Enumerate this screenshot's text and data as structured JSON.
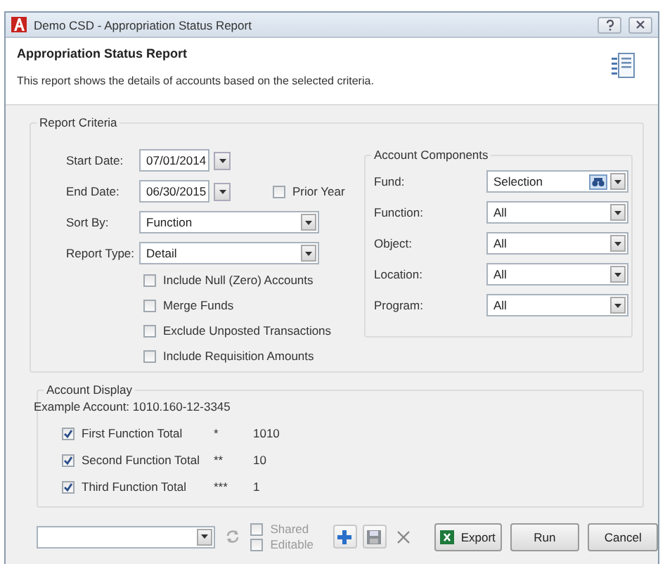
{
  "window": {
    "title": "Demo CSD - Appropriation Status Report"
  },
  "header": {
    "title": "Appropriation Status Report",
    "description": "This report shows the details of accounts based on the selected criteria."
  },
  "report_criteria": {
    "title": "Report Criteria",
    "start_date": {
      "label": "Start Date:",
      "value": "07/01/2014"
    },
    "end_date": {
      "label": "End Date:",
      "value": "06/30/2015"
    },
    "prior_year": {
      "label": "Prior Year",
      "checked": false
    },
    "sort_by": {
      "label": "Sort By:",
      "value": "Function"
    },
    "report_type": {
      "label": "Report Type:",
      "value": "Detail"
    },
    "options": [
      {
        "label": "Include Null (Zero) Accounts",
        "checked": false
      },
      {
        "label": "Merge Funds",
        "checked": false
      },
      {
        "label": "Exclude Unposted Transactions",
        "checked": false
      },
      {
        "label": "Include Requisition Amounts",
        "checked": false
      }
    ]
  },
  "account_components": {
    "title": "Account Components",
    "fields": [
      {
        "label": "Fund:",
        "value": "Selection",
        "kind": "picker"
      },
      {
        "label": "Function:",
        "value": "All",
        "kind": "combo"
      },
      {
        "label": "Object:",
        "value": "All",
        "kind": "combo"
      },
      {
        "label": "Location:",
        "value": "All",
        "kind": "combo"
      },
      {
        "label": "Program:",
        "value": "All",
        "kind": "combo"
      }
    ]
  },
  "account_display": {
    "title": "Account Display",
    "example": "Example Account: 1010.160-12-3345",
    "rows": [
      {
        "label": "First Function Total",
        "checked": true,
        "marker": "*",
        "value": "1010"
      },
      {
        "label": "Second Function Total",
        "checked": true,
        "marker": "**",
        "value": "10"
      },
      {
        "label": "Third Function Total",
        "checked": true,
        "marker": "***",
        "value": "1"
      }
    ]
  },
  "toolbar": {
    "shared": {
      "label": "Shared",
      "checked": false
    },
    "editable": {
      "label": "Editable",
      "checked": false
    },
    "buttons": [
      {
        "label": "Export",
        "kind": "export"
      },
      {
        "label": "Run",
        "kind": "plain"
      },
      {
        "label": "Cancel",
        "kind": "plain"
      }
    ]
  }
}
